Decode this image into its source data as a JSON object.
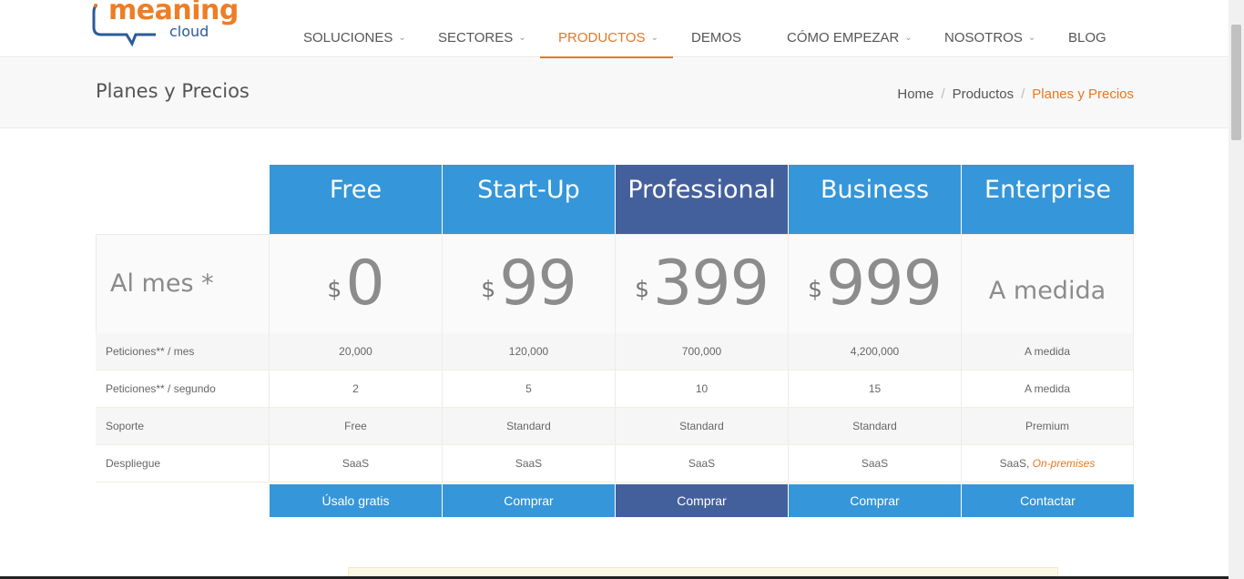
{
  "logo": {
    "word": "meaning",
    "sub": "cloud"
  },
  "nav": {
    "items": [
      {
        "label": "SOLUCIONES",
        "dropdown": true
      },
      {
        "label": "SECTORES",
        "dropdown": true
      },
      {
        "label": "PRODUCTOS",
        "dropdown": true,
        "active": true
      },
      {
        "label": "DEMOS",
        "dropdown": false
      },
      {
        "label": "CÓMO EMPEZAR",
        "dropdown": true
      },
      {
        "label": "NOSOTROS",
        "dropdown": true
      },
      {
        "label": "BLOG",
        "dropdown": false
      }
    ],
    "chevron": "⌄"
  },
  "page": {
    "title": "Planes y Precios",
    "breadcrumb": [
      "Home",
      "Productos",
      "Planes y Precios"
    ],
    "breadcrumb_sep": "/"
  },
  "pricing": {
    "period_label": "Al mes *",
    "currency": "$",
    "plans": [
      {
        "name": "Free",
        "price": "0",
        "button": "Úsalo gratis"
      },
      {
        "name": "Start-Up",
        "price": "99",
        "button": "Comprar"
      },
      {
        "name": "Professional",
        "price": "399",
        "button": "Comprar",
        "highlight": true
      },
      {
        "name": "Business",
        "price": "999",
        "button": "Comprar"
      },
      {
        "name": "Enterprise",
        "price_text": "A medida",
        "button": "Contactar"
      }
    ],
    "features": [
      {
        "label": "Peticiones** / mes",
        "values": [
          "20,000",
          "120,000",
          "700,000",
          "4,200,000",
          "A medida"
        ]
      },
      {
        "label": "Peticiones** / segundo",
        "values": [
          "2",
          "5",
          "10",
          "15",
          "A medida"
        ]
      },
      {
        "label": "Soporte",
        "values": [
          "Free",
          "Standard",
          "Standard",
          "Standard",
          "Premium"
        ]
      },
      {
        "label": "Despliegue",
        "values": [
          "SaaS",
          "SaaS",
          "SaaS",
          "SaaS",
          "SaaS, "
        ],
        "enterprise_extra": "On-premises"
      }
    ]
  },
  "colors": {
    "brand_orange": "#e87722",
    "plan_blue": "#3596d9",
    "plan_highlight": "#44609c"
  }
}
